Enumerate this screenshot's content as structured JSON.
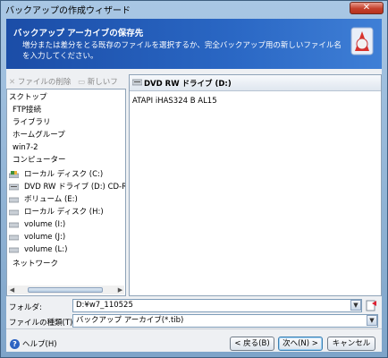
{
  "window": {
    "title": "バックアップの作成ウィザード",
    "close_label": "✕"
  },
  "header": {
    "title": "バックアップ アーカイブの保存先",
    "description": "増分または差分をとる既存のファイルを選択するか、完全バックアップ用の新しいファイル名を入力してください。"
  },
  "toolbar": {
    "delete_label": "ファイルの削除",
    "new_label": "新しいフ"
  },
  "tree": {
    "items": [
      {
        "label": "スクトップ",
        "icon": "desktop-icon"
      },
      {
        "label": "FTP接続",
        "icon": ""
      },
      {
        "label": "ライブラリ",
        "icon": ""
      },
      {
        "label": "ホームグループ",
        "icon": ""
      },
      {
        "label": "win7-2",
        "icon": ""
      },
      {
        "label": "コンピューター",
        "icon": ""
      },
      {
        "label": "ローカル ディスク (C:)",
        "icon": "system-drive-icon"
      },
      {
        "label": "DVD RW ドライブ (D:) CD-RW",
        "icon": "dvd-drive-icon"
      },
      {
        "label": "ボリューム (E:)",
        "icon": "drive-icon"
      },
      {
        "label": "ローカル ディスク (H:)",
        "icon": "drive-icon"
      },
      {
        "label": "volume (I:)",
        "icon": "drive-icon"
      },
      {
        "label": "volume (J:)",
        "icon": "drive-icon"
      },
      {
        "label": "volume (L:)",
        "icon": "drive-icon"
      },
      {
        "label": "ネットワーク",
        "icon": ""
      }
    ]
  },
  "detail": {
    "title": "DVD RW ドライブ (D:)",
    "info": "ATAPI iHAS324   B AL15"
  },
  "folder": {
    "label": "フォルダ:",
    "value": "D:¥w7_110525"
  },
  "filetype": {
    "label": "ファイルの種類(T):",
    "value": "バックアップ アーカイブ(*.tib)"
  },
  "footer": {
    "help_label": "ヘルプ(H)",
    "back_label": "< 戻る(B)",
    "next_label": "次へ(N) >",
    "cancel_label": "キャンセル"
  },
  "colors": {
    "header_bg": "#2a67c4",
    "accent": "#1b4da7"
  }
}
